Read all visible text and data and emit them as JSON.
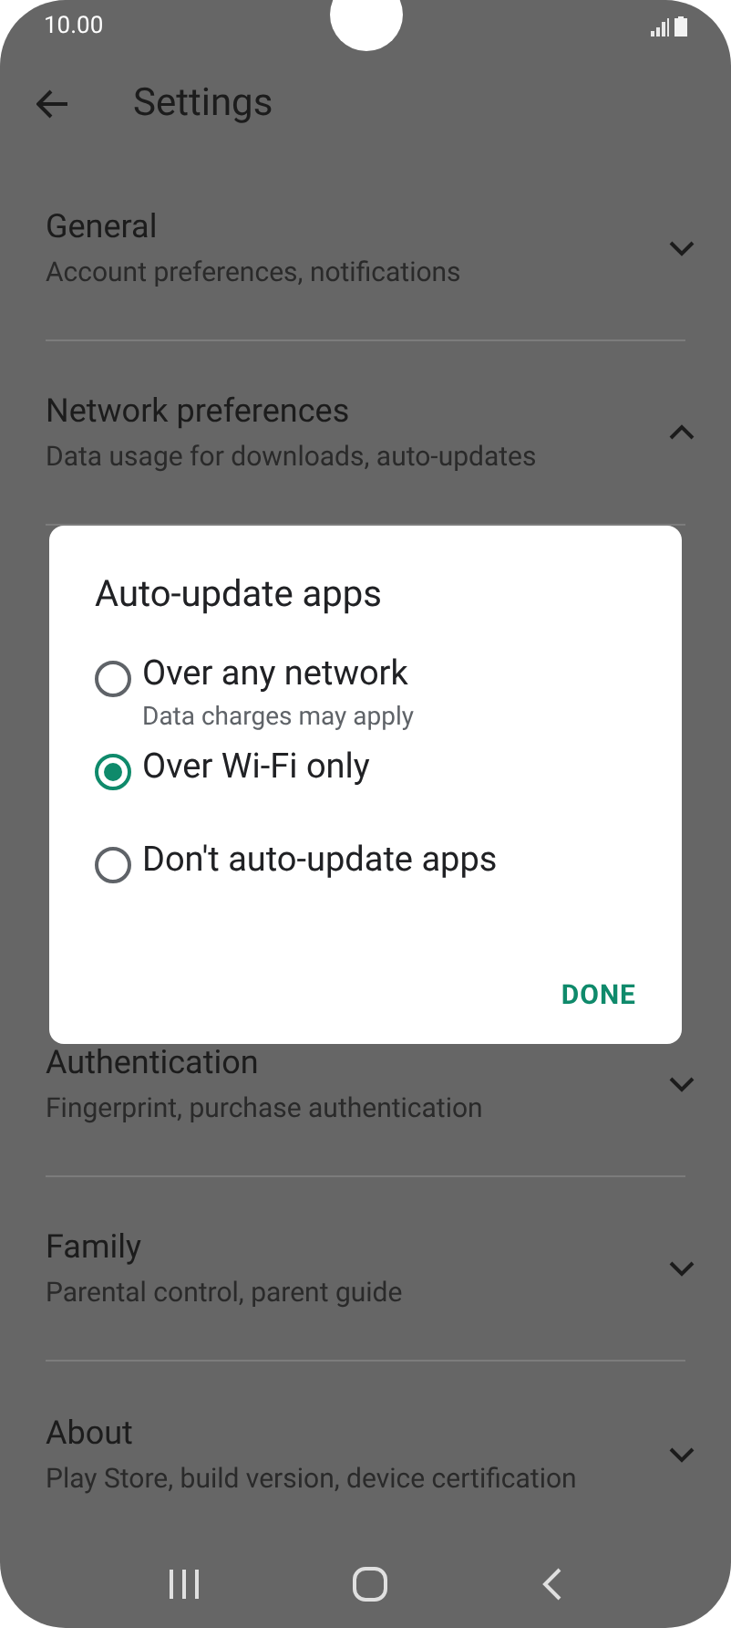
{
  "status_bar": {
    "time": "10.00"
  },
  "header": {
    "title": "Settings"
  },
  "settings_top": [
    {
      "title": "General",
      "subtitle": "Account preferences, notifications",
      "expanded": false
    },
    {
      "title": "Network preferences",
      "subtitle": "Data usage for downloads, auto-updates",
      "expanded": true
    }
  ],
  "settings_bottom": [
    {
      "title": "Authentication",
      "subtitle": "Fingerprint, purchase authentication",
      "expanded": false
    },
    {
      "title": "Family",
      "subtitle": "Parental control, parent guide",
      "expanded": false
    },
    {
      "title": "About",
      "subtitle": "Play Store, build version, device certification",
      "expanded": false
    }
  ],
  "dialog": {
    "title": "Auto-update apps",
    "options": [
      {
        "label": "Over any network",
        "subtitle": "Data charges may apply",
        "selected": false
      },
      {
        "label": "Over Wi-Fi only",
        "selected": true
      },
      {
        "label": "Don't auto-update apps",
        "selected": false
      }
    ],
    "button": "DONE"
  }
}
